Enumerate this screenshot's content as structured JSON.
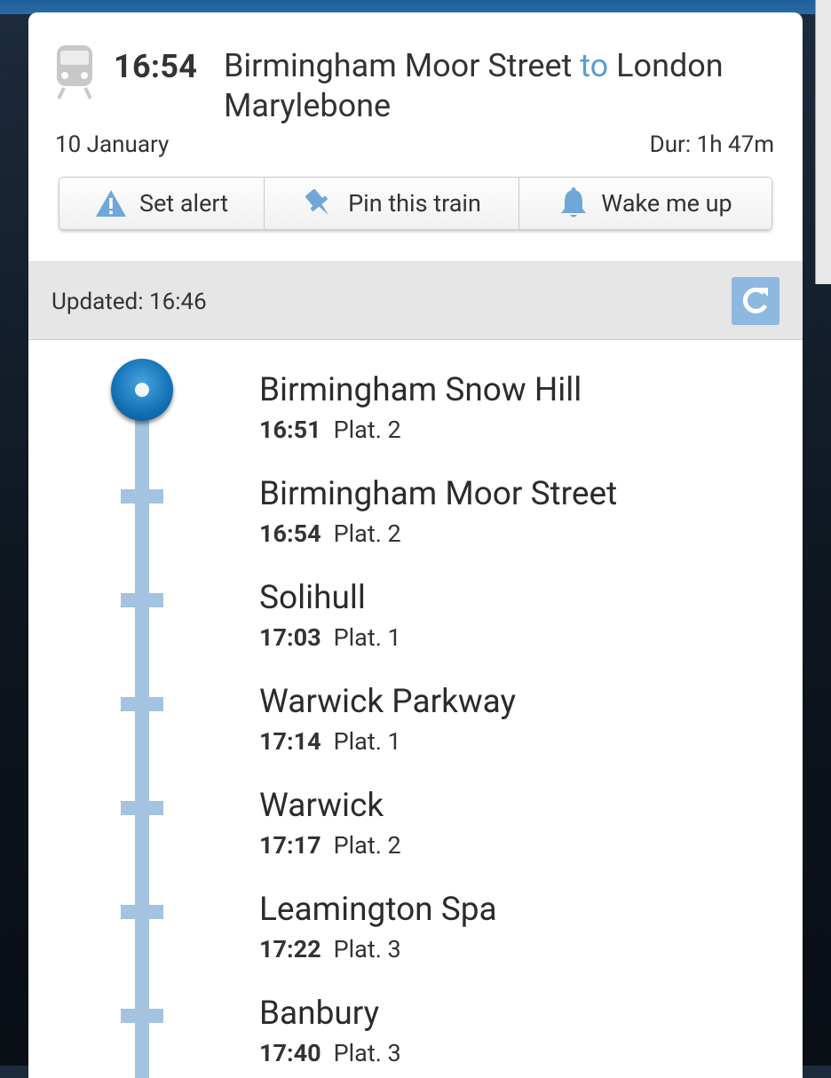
{
  "header": {
    "departure_time": "16:54",
    "origin": "Birmingham Moor Street",
    "connector": "to",
    "destination": "London Marylebone",
    "date": "10 January",
    "duration": "Dur: 1h 47m"
  },
  "actions": {
    "set_alert": "Set alert",
    "pin_train": "Pin this train",
    "wake_me_up": "Wake me up"
  },
  "status": {
    "updated": "Updated: 16:46"
  },
  "stops": [
    {
      "name": "Birmingham Snow Hill",
      "time": "16:51",
      "platform": "Plat. 2"
    },
    {
      "name": "Birmingham Moor Street",
      "time": "16:54",
      "platform": "Plat. 2"
    },
    {
      "name": "Solihull",
      "time": "17:03",
      "platform": "Plat. 1"
    },
    {
      "name": "Warwick Parkway",
      "time": "17:14",
      "platform": "Plat. 1"
    },
    {
      "name": "Warwick",
      "time": "17:17",
      "platform": "Plat. 2"
    },
    {
      "name": "Leamington Spa",
      "time": "17:22",
      "platform": "Plat. 3"
    },
    {
      "name": "Banbury",
      "time": "17:40",
      "platform": "Plat. 3"
    }
  ],
  "colors": {
    "accent": "#5b9bd5",
    "track": "#a3c3e0",
    "current_stop": "#1576b9"
  },
  "icons": [
    "train-icon",
    "warning-icon",
    "pin-icon",
    "bell-icon",
    "refresh-icon"
  ]
}
